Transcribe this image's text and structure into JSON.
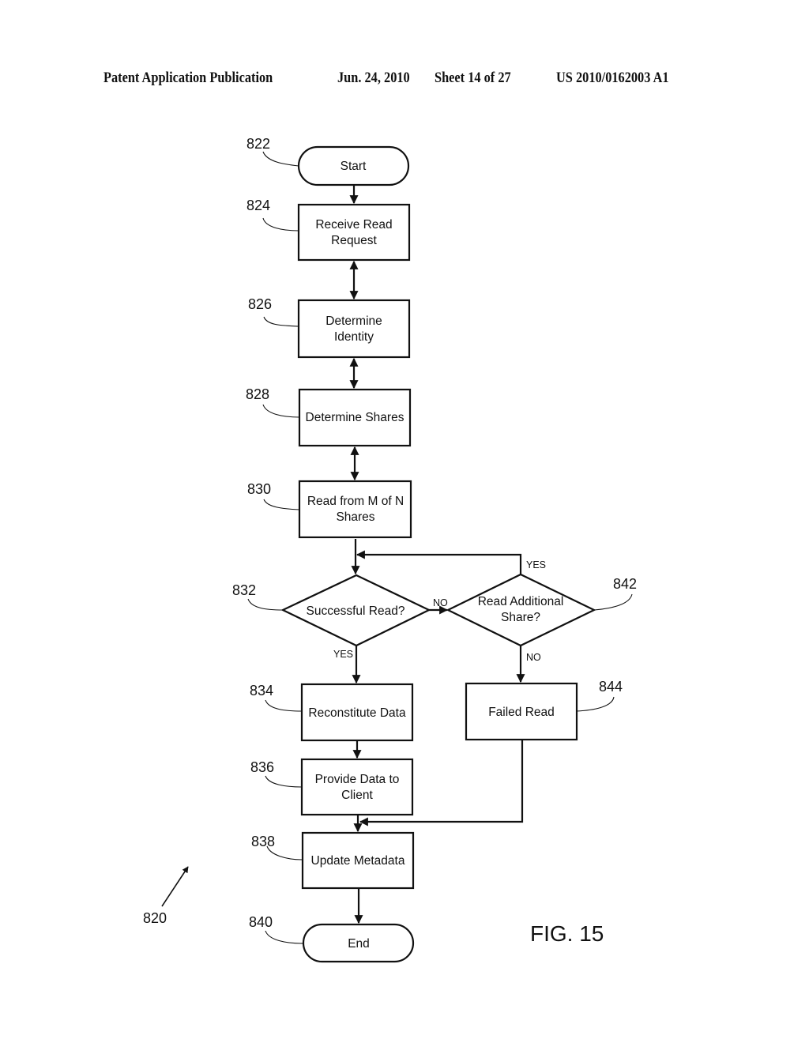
{
  "header": {
    "publication_type": "Patent Application Publication",
    "date": "Jun. 24, 2010",
    "sheet": "Sheet 14 of 27",
    "publication_number": "US 2010/0162003 A1"
  },
  "figure": {
    "label": "FIG. 15",
    "reference": "820",
    "nodes": [
      {
        "id": "822",
        "type": "terminal",
        "lines": [
          "Start"
        ]
      },
      {
        "id": "824",
        "type": "process",
        "lines": [
          "Receive Read",
          "Request"
        ]
      },
      {
        "id": "826",
        "type": "process",
        "lines": [
          "Determine",
          "Identity"
        ]
      },
      {
        "id": "828",
        "type": "process",
        "lines": [
          "Determine Shares"
        ]
      },
      {
        "id": "830",
        "type": "process",
        "lines": [
          "Read from M of N",
          "Shares"
        ]
      },
      {
        "id": "832",
        "type": "decision",
        "lines": [
          "Successful Read?"
        ]
      },
      {
        "id": "842",
        "type": "decision",
        "lines": [
          "Read Additional",
          "Share?"
        ]
      },
      {
        "id": "834",
        "type": "process",
        "lines": [
          "Reconstitute Data"
        ]
      },
      {
        "id": "844",
        "type": "process",
        "lines": [
          "Failed Read"
        ]
      },
      {
        "id": "836",
        "type": "process",
        "lines": [
          "Provide Data to",
          "Client"
        ]
      },
      {
        "id": "838",
        "type": "process",
        "lines": [
          "Update Metadata"
        ]
      },
      {
        "id": "840",
        "type": "terminal",
        "lines": [
          "End"
        ]
      }
    ],
    "edges": [
      {
        "from": "822",
        "to": "824",
        "label": ""
      },
      {
        "from": "824",
        "to": "826",
        "label": "",
        "bidirectional": true
      },
      {
        "from": "826",
        "to": "828",
        "label": "",
        "bidirectional": true
      },
      {
        "from": "828",
        "to": "830",
        "label": "",
        "bidirectional": true
      },
      {
        "from": "830",
        "to": "832",
        "label": ""
      },
      {
        "from": "832",
        "to": "842",
        "label": "NO"
      },
      {
        "from": "842",
        "to": "832",
        "label": "YES"
      },
      {
        "from": "832",
        "to": "834",
        "label": "YES"
      },
      {
        "from": "842",
        "to": "844",
        "label": "NO"
      },
      {
        "from": "834",
        "to": "836",
        "label": ""
      },
      {
        "from": "836",
        "to": "838",
        "label": ""
      },
      {
        "from": "844",
        "to": "838",
        "label": ""
      },
      {
        "from": "838",
        "to": "840",
        "label": ""
      }
    ]
  }
}
